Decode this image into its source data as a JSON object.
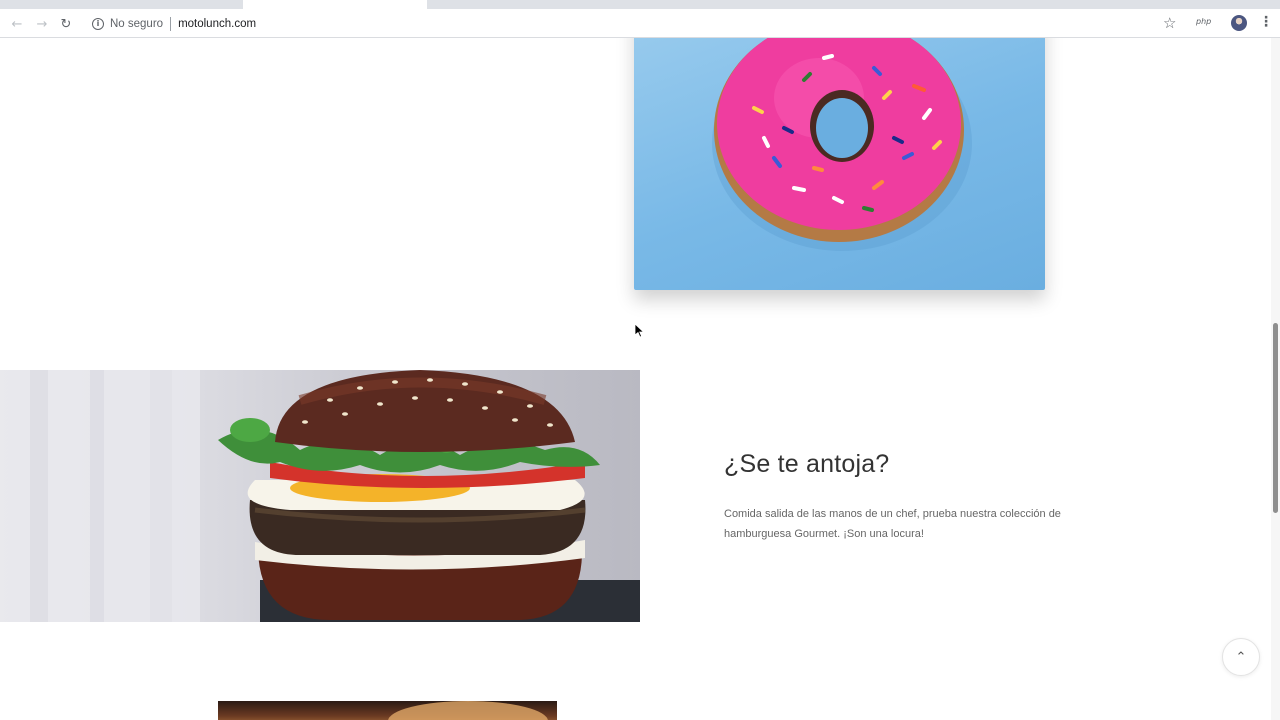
{
  "browser": {
    "security_label": "No seguro",
    "url": "motolunch.com",
    "extension_label": "php",
    "icons": [
      "back-icon",
      "forward-icon",
      "reload-icon",
      "info-icon",
      "star-icon",
      "profile-avatar",
      "menu-icon"
    ]
  },
  "feature": {
    "title": "¿Se te antoja?",
    "description": "Comida salida de las manos de un chef, prueba nuestra colección de hamburguesa Gourmet. ¡Son una locura!"
  },
  "colors": {
    "donut_background": "#7dbbe8",
    "donut_icing": "#ef3d9f",
    "text_heading": "#333333",
    "text_body": "#666666"
  }
}
